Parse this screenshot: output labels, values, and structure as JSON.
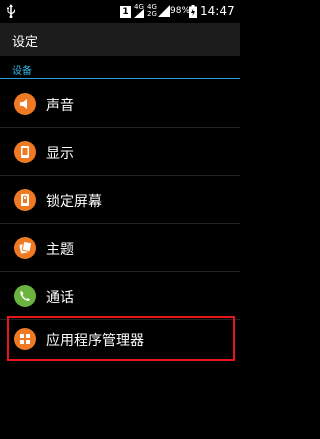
{
  "status_bar": {
    "sim_badge": "1",
    "net_1": "4G",
    "net_2": "4G",
    "net_3": "2G",
    "battery_percent": "98%",
    "time": "14:47"
  },
  "title_bar": {
    "title": "设定"
  },
  "section": {
    "label": "设备"
  },
  "items": [
    {
      "label": "声音",
      "icon": "volume-icon",
      "color": "#f07a24"
    },
    {
      "label": "显示",
      "icon": "display-icon",
      "color": "#f07a24"
    },
    {
      "label": "锁定屏幕",
      "icon": "lock-screen-icon",
      "color": "#f07a24"
    },
    {
      "label": "主题",
      "icon": "theme-icon",
      "color": "#f07a24"
    },
    {
      "label": "通话",
      "icon": "phone-icon",
      "color": "#6ab33e"
    },
    {
      "label": "应用程序管理器",
      "icon": "app-manager-icon",
      "color": "#f07a24"
    }
  ],
  "highlight_color": "#e8151b",
  "accent_color": "#33b5e5"
}
